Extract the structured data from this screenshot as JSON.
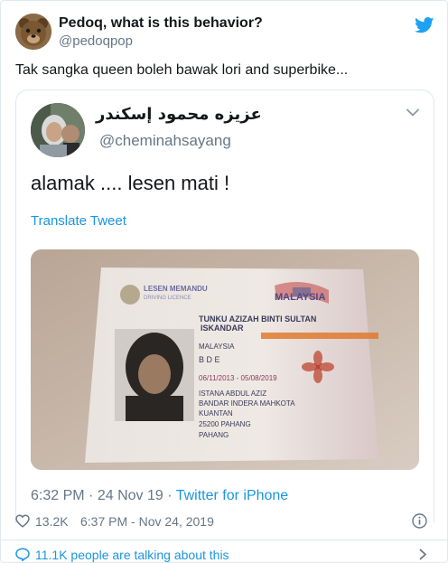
{
  "outer_tweet": {
    "display_name": "Pedoq, what is this behavior?",
    "handle": "@pedoqpop",
    "text": "Tak sangka queen boleh bawak lori and superbike...",
    "avatar_icon": "bear-avatar",
    "brand_icon": "twitter-bird-icon",
    "brand_color": "#1da1f2"
  },
  "quoted_tweet": {
    "display_name": "عزيزه محمود إسكندر",
    "handle": "@cheminahsayang",
    "text": "alamak .... lesen mati !",
    "translate_label": "Translate Tweet",
    "time": "6:32 PM",
    "date": "24 Nov 19",
    "separator": "·",
    "source": "Twitter for iPhone",
    "media_alt_icon": "driving-licence-photo"
  },
  "license_card": {
    "header": "LESEN MEMANDU",
    "subheader": "DRIVING LICENCE",
    "country": "MALAYSIA",
    "name_line1": "TUNKU AZIZAH BINTI SULTAN",
    "name_line2": "ISKANDAR",
    "nationality": "MALAYSIA",
    "class": "B D E",
    "validity": "06/11/2013 - 05/08/2019",
    "address_line1": "ISTANA ABDUL AZIZ",
    "address_line2": "BANDAR INDERA MAHKOTA",
    "address_line3": "KUANTAN",
    "address_line4": "25200 PAHANG",
    "address_line5": "PAHANG"
  },
  "footer": {
    "like_count": "13.2K",
    "date": "6:37 PM - Nov 24, 2019",
    "talking_text": "11.1K people are talking about this"
  },
  "colors": {
    "link": "#1b95e0",
    "muted": "#657786",
    "border": "#e1e8ed"
  }
}
